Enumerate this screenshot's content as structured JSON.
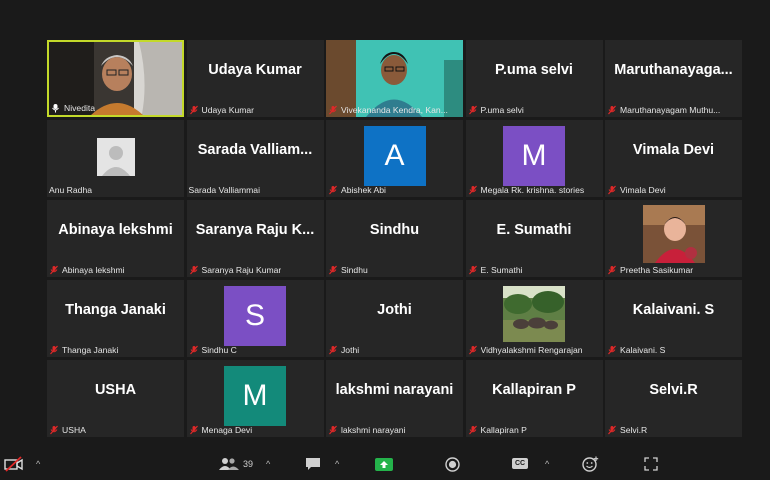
{
  "participants": [
    {
      "big": "",
      "label": "Nivedita",
      "muted": false,
      "kind": "video-self",
      "active": true
    },
    {
      "big": "Udaya Kumar",
      "label": "Udaya Kumar",
      "muted": true,
      "kind": "name"
    },
    {
      "big": "",
      "label": "Vivekananda Kendra, Kan...",
      "muted": true,
      "kind": "video-woman"
    },
    {
      "big": "P.uma selvi",
      "label": "P.uma selvi",
      "muted": true,
      "kind": "name"
    },
    {
      "big": "Maruthanayaga...",
      "label": "Maruthanayagam Muthu...",
      "muted": true,
      "kind": "name"
    },
    {
      "big": "",
      "label": "Anu Radha",
      "muted": false,
      "kind": "placeholder"
    },
    {
      "big": "Sarada  Valliam...",
      "label": "Sarada Valliammai",
      "muted": false,
      "kind": "name"
    },
    {
      "big": "",
      "label": "Abishek Abi",
      "muted": true,
      "kind": "letter",
      "letter": "A",
      "color": "#0e72c5"
    },
    {
      "big": "",
      "label": "Megala Rk. krishna. stories",
      "muted": true,
      "kind": "letter",
      "letter": "M",
      "color": "#7b4fc4"
    },
    {
      "big": "Vimala Devi",
      "label": "Vimala Devi",
      "muted": true,
      "kind": "name"
    },
    {
      "big": "Abinaya lekshmi",
      "label": "Abinaya lekshmi",
      "muted": true,
      "kind": "name"
    },
    {
      "big": "Saranya  Raju  K...",
      "label": "Saranya Raju Kumar",
      "muted": true,
      "kind": "name"
    },
    {
      "big": "Sindhu",
      "label": "Sindhu",
      "muted": true,
      "kind": "name"
    },
    {
      "big": "E. Sumathi",
      "label": "E. Sumathi",
      "muted": true,
      "kind": "name"
    },
    {
      "big": "",
      "label": "Preetha Sasikumar",
      "muted": true,
      "kind": "video-baby"
    },
    {
      "big": "Thanga Janaki",
      "label": "Thanga Janaki",
      "muted": true,
      "kind": "name"
    },
    {
      "big": "",
      "label": "Sindhu C",
      "muted": true,
      "kind": "letter",
      "letter": "S",
      "color": "#7b4fc4"
    },
    {
      "big": "Jothi",
      "label": "Jothi",
      "muted": true,
      "kind": "name"
    },
    {
      "big": "",
      "label": "Vidhyalakshmi Rengarajan",
      "muted": true,
      "kind": "video-elephants"
    },
    {
      "big": "Kalaivani. S",
      "label": "Kalaivani. S",
      "muted": true,
      "kind": "name"
    },
    {
      "big": "USHA",
      "label": "USHA",
      "muted": true,
      "kind": "name"
    },
    {
      "big": "",
      "label": "Menaga Devi",
      "muted": true,
      "kind": "letter",
      "letter": "M",
      "color": "#138a7a"
    },
    {
      "big": "lakshmi narayani",
      "label": "lakshmi narayani",
      "muted": true,
      "kind": "name"
    },
    {
      "big": "Kallapiran P",
      "label": "Kallapiran P",
      "muted": true,
      "kind": "name"
    },
    {
      "big": "Selvi.R",
      "label": "Selvi.R",
      "muted": true,
      "kind": "name"
    }
  ],
  "toolbar": {
    "participant_count": "39",
    "cc_label": "CC",
    "caret": "^"
  },
  "colors": {
    "active_border": "#c3d92a",
    "mute_red": "#e02828",
    "share_green": "#24b34b"
  }
}
